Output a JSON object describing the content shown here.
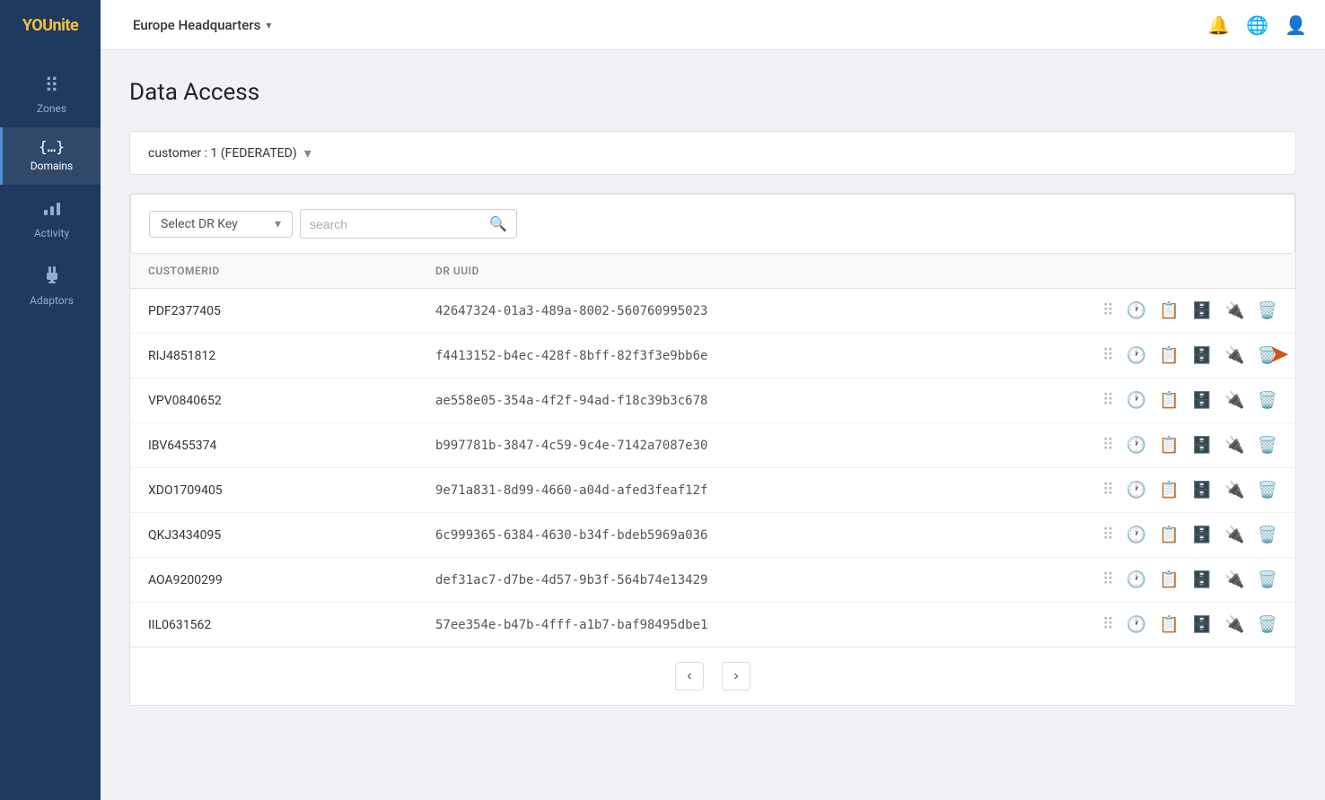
{
  "app": {
    "logo": "YOUnite",
    "logo_highlight": "YOU"
  },
  "topnav": {
    "org_name": "Europe Headquarters",
    "chevron": "▾",
    "icons": [
      "bell",
      "globe",
      "user"
    ]
  },
  "sidebar": {
    "items": [
      {
        "id": "zones",
        "label": "Zones",
        "icon": "⠿",
        "active": false
      },
      {
        "id": "domains",
        "label": "Domains",
        "icon": "{…}",
        "active": true
      },
      {
        "id": "activity",
        "label": "Activity",
        "icon": "📊",
        "active": false
      },
      {
        "id": "adaptors",
        "label": "Adaptors",
        "icon": "🔌",
        "active": false
      }
    ]
  },
  "page": {
    "title": "Data Access"
  },
  "customer_selector": {
    "value": "customer : 1 (FEDERATED)",
    "chevron": "▾"
  },
  "filters": {
    "dr_key_placeholder": "Select DR Key",
    "search_placeholder": "search",
    "chevron": "▾"
  },
  "table": {
    "columns": [
      {
        "id": "customerid",
        "label": "CUSTOMERID"
      },
      {
        "id": "druuid",
        "label": "DR UUID"
      }
    ],
    "rows": [
      {
        "customerid": "PDF2377405",
        "druuid": "42647324-01a3-489a-8002-560760995023"
      },
      {
        "customerid": "RIJ4851812",
        "druuid": "f4413152-b4ec-428f-8bff-82f3f3e9bb6e"
      },
      {
        "customerid": "VPV0840652",
        "druuid": "ae558e05-354a-4f2f-94ad-f18c39b3c678"
      },
      {
        "customerid": "IBV6455374",
        "druuid": "b997781b-3847-4c59-9c4e-7142a7087e30"
      },
      {
        "customerid": "XDO1709405",
        "druuid": "9e71a831-8d99-4660-a04d-afed3feaf12f"
      },
      {
        "customerid": "QKJ3434095",
        "druuid": "6c999365-6384-4630-b34f-bdeb5969a036"
      },
      {
        "customerid": "AOA9200299",
        "druuid": "def31ac7-d7be-4d57-9b3f-564b74e13429"
      },
      {
        "customerid": "IIL0631562",
        "druuid": "57ee354e-b47b-4fff-a1b7-baf98495dbe1"
      }
    ]
  },
  "pagination": {
    "prev": "‹",
    "next": "›"
  }
}
